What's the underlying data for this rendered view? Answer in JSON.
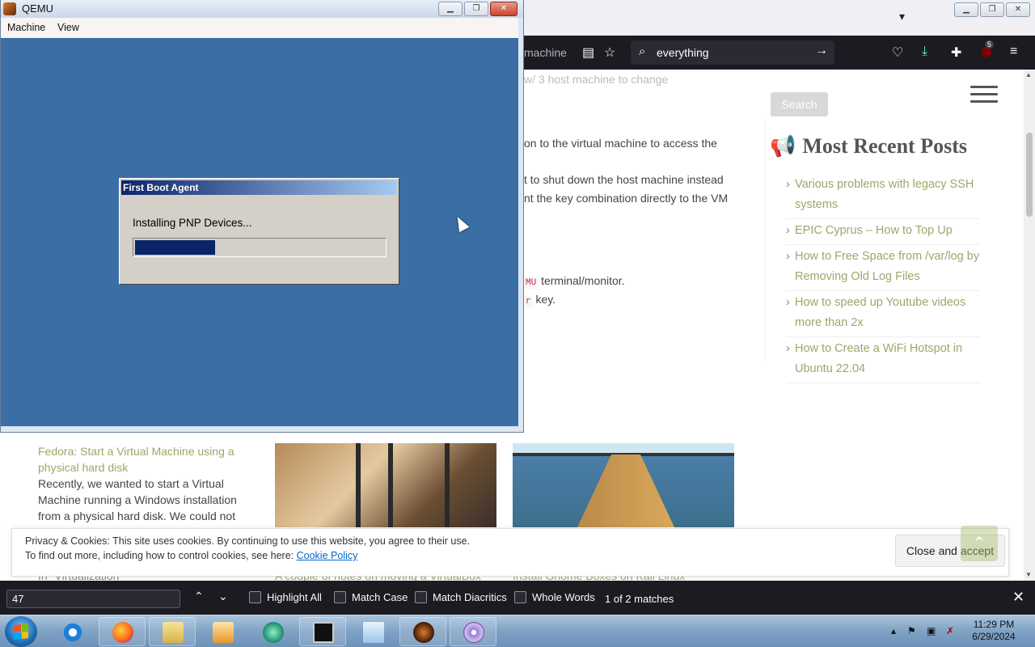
{
  "firefox": {
    "url_tail": "machine",
    "search_text": "everything",
    "ublock_count": "5"
  },
  "article": {
    "line_top": "w/    3 host machine to change",
    "line2": "on to the virtual machine to access the",
    "line3": "t to shut down the host machine instead",
    "line4": "nt the key combination directly to the VM",
    "code_frag": "MU",
    "line5": "terminal/monitor.",
    "code_frag2": "r",
    "line6": "key."
  },
  "sidebar": {
    "search_button": "Search",
    "recent_title": "Most Recent Posts",
    "recent_posts": [
      "Various problems with legacy SSH systems",
      "EPIC Cyprus – How to Top Up",
      "How to Free Space from /var/log by Removing Old Log Files",
      "How to speed up Youtube videos more than 2x",
      "How to Create a WiFi Hotspot in Ubuntu 22.04"
    ]
  },
  "posts": {
    "card_title": "Fedora: Start a Virtual Machine using a physical hard disk",
    "card_text": "Recently, we wanted to start a Virtual Machine running a Windows installation from a physical hard disk. We could not",
    "link_category": "In \"Virtualization\"",
    "link_2": "A couple of notes on moving a VirtualBox",
    "link_3": "Install Gnome Boxes on Kali Linux"
  },
  "cookie": {
    "line1": "Privacy & Cookies: This site uses cookies. By continuing to use this website, you agree to their use.",
    "line2": "To find out more, including how to control cookies, see here:",
    "policy_link": "Cookie Policy",
    "close_button": "Close and accept"
  },
  "findbar": {
    "query": "47",
    "highlight_all": "Highlight All",
    "match_case": "Match Case",
    "match_diacritics": "Match Diacritics",
    "whole_words": "Whole Words",
    "status": "1 of 2 matches"
  },
  "qemu": {
    "title": "QEMU",
    "menu_machine": "Machine",
    "menu_view": "View"
  },
  "vm": {
    "dialog_title": "First Boot Agent",
    "dialog_message": "Installing PNP Devices...",
    "progress": 0.32
  },
  "taskbar": {
    "time": "11:29 PM",
    "date": "6/29/2024"
  },
  "colors": {
    "vm_desktop": "#3a6ea5",
    "firefox_dark": "#1c1b22",
    "link_olive": "#a2a46a"
  }
}
